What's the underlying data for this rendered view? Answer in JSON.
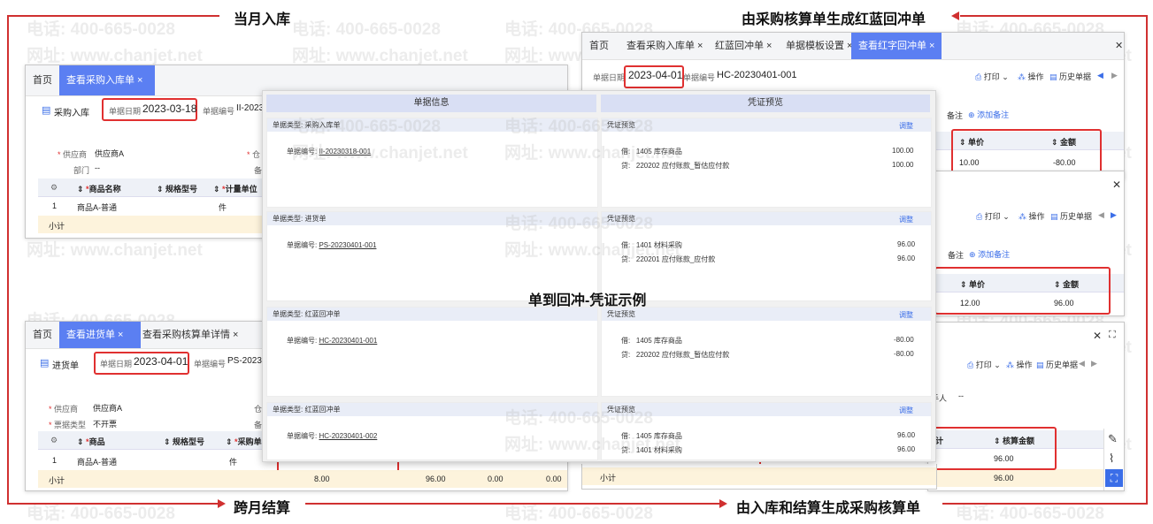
{
  "watermark": {
    "phone": "电话: 400-665-0028",
    "site": "网址: www.chanjet.net"
  },
  "annotations": {
    "top_left": "当月入库",
    "top_right": "由采购核算单生成红蓝回冲单",
    "bottom_left": "跨月结算",
    "bottom_right": "由入库和结算生成采购核算单",
    "center": "单到回冲-凭证示例"
  },
  "win_a": {
    "tab_home": "首页",
    "tab_active": "查看采购入库单 ×",
    "doc_type": "采购入库",
    "date_label": "单据日期",
    "date_value": "2023-03-18",
    "num_label": "单据编号",
    "num_value": "II-2023",
    "supplier_label": "供应商",
    "supplier_value": "供应商A",
    "dept_label": "部门",
    "dept_value": "--",
    "wh_label": "仓",
    "extra_label": "备",
    "cols": [
      "商品名称",
      "规格型号",
      "计量单位"
    ],
    "row_index": "1",
    "row_product": "商品A-普通",
    "row_unit": "件",
    "subtotal": "小计"
  },
  "win_b": {
    "tabs": [
      "首页",
      "查看采购入库单 ×",
      "红蓝回冲单 ×",
      "单据模板设置 ×",
      "查看红字回冲单 ×"
    ],
    "date_label": "单据日期",
    "date_value": "2023-04-01",
    "num_label": "单据编号",
    "num_value": "HC-20230401-001",
    "tool_print": "打印",
    "tool_op": "操作",
    "tool_history": "历史单据",
    "remark_label": "备注",
    "add_remark": "添加备注",
    "col_price": "单价",
    "col_amount": "金额",
    "price": "10.00",
    "amount": "-80.00"
  },
  "win_c": {
    "tool_print": "打印",
    "tool_op": "操作",
    "tool_history": "历史单据",
    "remark_label": "备注",
    "add_remark": "添加备注",
    "col_price": "单价",
    "col_amount": "金额",
    "price": "12.00",
    "amount": "96.00"
  },
  "win_d": {
    "tool_print": "打印",
    "tool_op": "操作",
    "tool_history": "历史单据",
    "handler_label": "经手人",
    "handler_value": "--",
    "col_sum": "核算金额",
    "col_partial": "计",
    "sum_value": "96.00",
    "subtotal": "小计",
    "subtotal_value": "96.00"
  },
  "win_e": {
    "tabs": [
      "首页",
      "查看进货单 ×",
      "查看采购核算单详情 ×"
    ],
    "doc_type": "进货单",
    "date_label": "单据日期",
    "date_value": "2023-04-01",
    "num_label": "单据编号",
    "num_value": "PS-2023",
    "supplier_label": "供应商",
    "supplier_value": "供应商A",
    "invoice_label": "票据类型",
    "invoice_value": "不开票",
    "wh_label": "仓",
    "extra_label": "备",
    "cols": [
      "商品",
      "规格型号",
      "采购单位"
    ],
    "row_index": "1",
    "row_product": "商品A-普通",
    "row_unit": "件",
    "subtotal": "小计",
    "sub_qty": "8.00",
    "sub_amount": "96.00",
    "sub_a": "0.00",
    "sub_b": "0.00"
  },
  "center_panel": {
    "left_title": "单据信息",
    "right_title": "凭证预览",
    "adjust": "调整",
    "type_label": "单据类型:",
    "num_label": "单据编号:",
    "voucher_label": "凭证预览",
    "entries": [
      {
        "type": "采购入库单",
        "num": "II-20230318-001",
        "debit_label": "借:",
        "debit_acct": "1405  库存商品",
        "debit_amt": "100.00",
        "credit_label": "贷:",
        "credit_acct": "220202  应付账款_暂估应付款",
        "credit_amt": "100.00"
      },
      {
        "type": "进货单",
        "num": "PS-20230401-001",
        "debit_label": "借:",
        "debit_acct": "1401  材料采购",
        "debit_amt": "96.00",
        "credit_label": "贷:",
        "credit_acct": "220201  应付账款_应付款",
        "credit_amt": "96.00"
      },
      {
        "type": "红蓝回冲单",
        "num": "HC-20230401-001",
        "debit_label": "借:",
        "debit_acct": "1405  库存商品",
        "debit_amt": "-80.00",
        "credit_label": "贷:",
        "credit_acct": "220202  应付账款_暂估应付款",
        "credit_amt": "-80.00"
      },
      {
        "type": "红蓝回冲单",
        "num": "HC-20230401-002",
        "debit_label": "借:",
        "debit_acct": "1405  库存商品",
        "debit_amt": "96.00",
        "credit_label": "贷:",
        "credit_acct": "1401  材料采购",
        "credit_amt": "96.00"
      }
    ]
  }
}
